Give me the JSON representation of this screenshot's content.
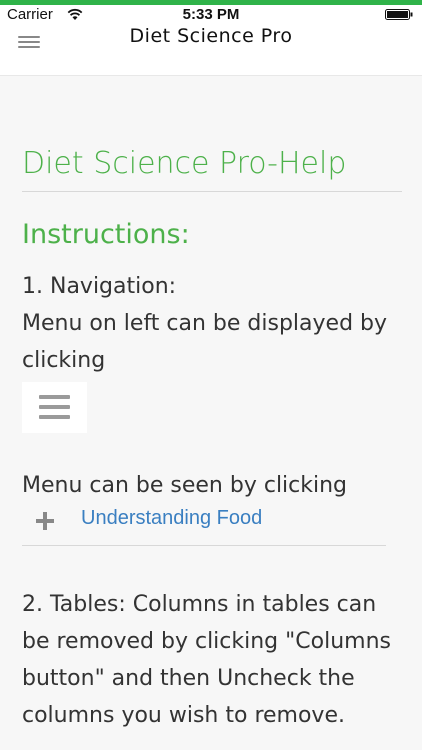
{
  "status_bar": {
    "carrier": "Carrier",
    "time": "5:33 PM",
    "icons": [
      "wifi-icon",
      "battery-icon"
    ]
  },
  "nav_bar": {
    "title": "Diet Science Pro",
    "menu_icon": "hamburger-menu-icon"
  },
  "content": {
    "page_title": "Diet Science Pro-Help",
    "section_title": "Instructions:",
    "nav_heading": "1. Navigation:",
    "nav_text": "Menu on left can be displayed by clicking",
    "menu_text": "Menu can be seen by clicking",
    "sample_menu_item": "Understanding Food",
    "tables_text": "2. Tables: Columns in tables can be removed by clicking \"Columns button\" and then Uncheck the columns you wish to remove."
  },
  "colors": {
    "accent_green": "#4db14a",
    "link_blue": "#3a7fc1",
    "top_bar_green": "#2fb349"
  }
}
